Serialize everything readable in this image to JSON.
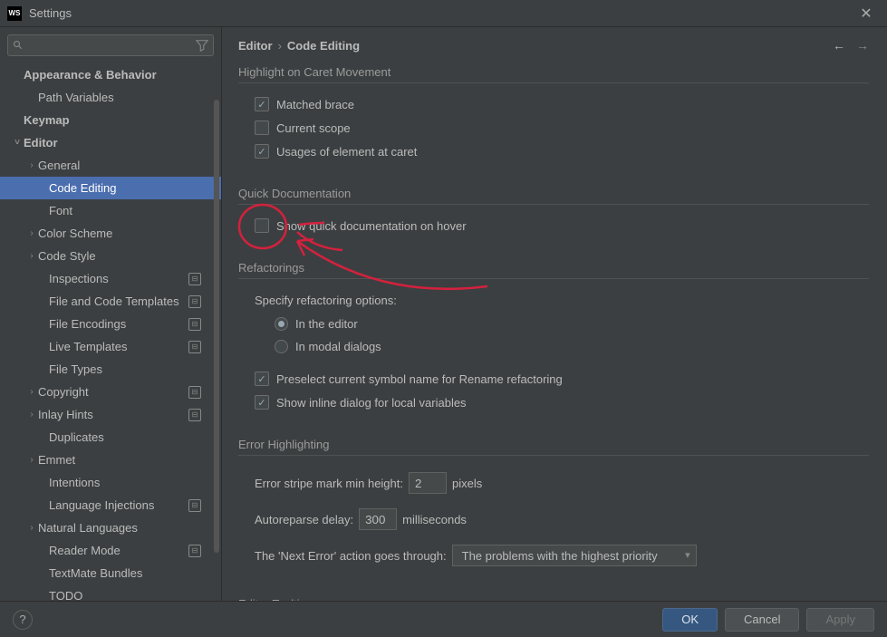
{
  "window": {
    "title": "Settings",
    "icon_label": "WS"
  },
  "search": {
    "placeholder": ""
  },
  "breadcrumb": {
    "root": "Editor",
    "leaf": "Code Editing"
  },
  "sidebar": {
    "items": [
      {
        "label": "Appearance & Behavior",
        "bold": true,
        "indent": 0,
        "exp": ""
      },
      {
        "label": "Path Variables",
        "indent": 1
      },
      {
        "label": "Keymap",
        "bold": true,
        "indent": 0
      },
      {
        "label": "Editor",
        "bold": true,
        "indent": 0,
        "exp": "˅"
      },
      {
        "label": "General",
        "indent": 1,
        "exp": "›"
      },
      {
        "label": "Code Editing",
        "indent": 2,
        "selected": true
      },
      {
        "label": "Font",
        "indent": 2
      },
      {
        "label": "Color Scheme",
        "indent": 1,
        "exp": "›"
      },
      {
        "label": "Code Style",
        "indent": 1,
        "exp": "›"
      },
      {
        "label": "Inspections",
        "indent": 2,
        "badge": true
      },
      {
        "label": "File and Code Templates",
        "indent": 2,
        "badge": true
      },
      {
        "label": "File Encodings",
        "indent": 2,
        "badge": true
      },
      {
        "label": "Live Templates",
        "indent": 2,
        "badge": true
      },
      {
        "label": "File Types",
        "indent": 2
      },
      {
        "label": "Copyright",
        "indent": 1,
        "exp": "›",
        "badge": true
      },
      {
        "label": "Inlay Hints",
        "indent": 1,
        "exp": "›",
        "badge": true
      },
      {
        "label": "Duplicates",
        "indent": 2
      },
      {
        "label": "Emmet",
        "indent": 1,
        "exp": "›"
      },
      {
        "label": "Intentions",
        "indent": 2
      },
      {
        "label": "Language Injections",
        "indent": 2,
        "badge": true
      },
      {
        "label": "Natural Languages",
        "indent": 1,
        "exp": "›"
      },
      {
        "label": "Reader Mode",
        "indent": 2,
        "badge": true
      },
      {
        "label": "TextMate Bundles",
        "indent": 2
      },
      {
        "label": "TODO",
        "indent": 2
      }
    ]
  },
  "sections": {
    "highlight": {
      "title": "Highlight on Caret Movement",
      "matched_brace": "Matched brace",
      "current_scope": "Current scope",
      "usages": "Usages of element at caret"
    },
    "quickdoc": {
      "title": "Quick Documentation",
      "hover": "Show quick documentation on hover"
    },
    "refactorings": {
      "title": "Refactorings",
      "specify": "Specify refactoring options:",
      "in_editor": "In the editor",
      "in_modal": "In modal dialogs",
      "preselect": "Preselect current symbol name for Rename refactoring",
      "inline_dialog": "Show inline dialog for local variables"
    },
    "error_hl": {
      "title": "Error Highlighting",
      "stripe_label_pre": "Error stripe mark min height:",
      "stripe_value": "2",
      "stripe_label_post": "pixels",
      "autoreparse_pre": "Autoreparse delay:",
      "autoreparse_value": "300",
      "autoreparse_post": "milliseconds",
      "next_error_pre": "The 'Next Error' action goes through:",
      "next_error_value": "The problems with the highest priority"
    },
    "tooltips": {
      "title": "Editor Tooltips"
    }
  },
  "footer": {
    "help": "?",
    "ok": "OK",
    "cancel": "Cancel",
    "apply": "Apply"
  }
}
